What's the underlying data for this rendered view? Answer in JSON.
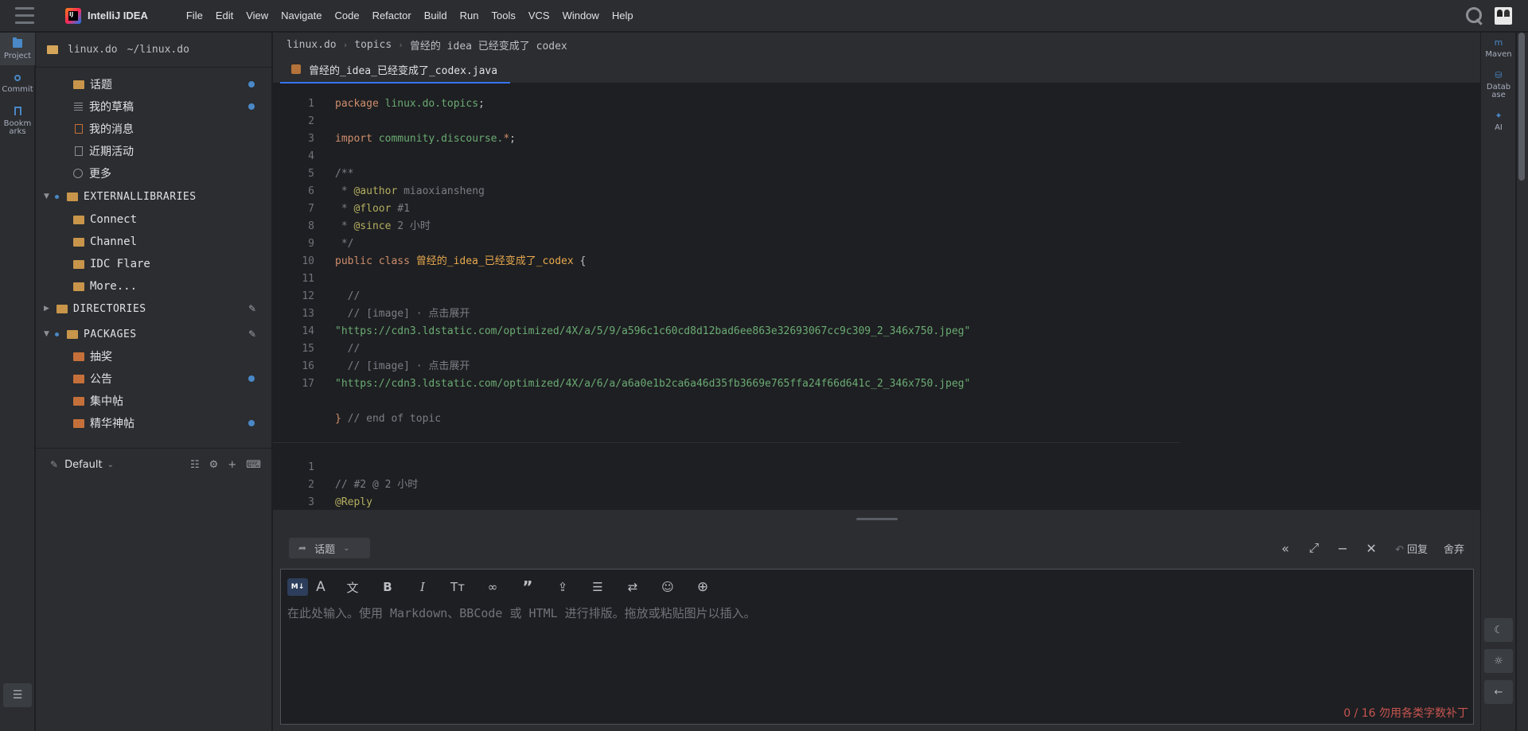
{
  "app": {
    "name": "IntelliJ IDEA"
  },
  "menu": [
    "File",
    "Edit",
    "View",
    "Navigate",
    "Code",
    "Refactor",
    "Build",
    "Run",
    "Tools",
    "VCS",
    "Window",
    "Help"
  ],
  "left_strip": [
    {
      "label": "Project",
      "icon": "folder-icon"
    },
    {
      "label": "Commit",
      "icon": "commit-icon"
    },
    {
      "label": "Bookmarks",
      "icon": "bookmark-icon"
    }
  ],
  "project": {
    "root": "linux.do",
    "path": "~/linux.do",
    "items": [
      {
        "label": "话题",
        "icon": "folder",
        "dot": true
      },
      {
        "label": "我的草稿",
        "icon": "lines",
        "dot": true
      },
      {
        "label": "我的消息",
        "icon": "file-orange",
        "dot": false
      },
      {
        "label": "近期活动",
        "icon": "file",
        "dot": false
      },
      {
        "label": "更多",
        "icon": "circle-x",
        "dot": false
      }
    ],
    "external": {
      "label": "EXTERNALLIBRARIES",
      "items": [
        "Connect",
        "Channel",
        "IDC Flare",
        "More..."
      ]
    },
    "directories": {
      "label": "DIRECTORIES"
    },
    "packages": {
      "label": "PACKAGES",
      "items": [
        {
          "label": "抽奖",
          "dot": false
        },
        {
          "label": "公告",
          "dot": true
        },
        {
          "label": "集中帖",
          "dot": false
        },
        {
          "label": "精华神帖",
          "dot": true
        }
      ]
    },
    "scheme": "Default"
  },
  "breadcrumb": [
    "linux.do",
    "topics",
    "曾经的 idea 已经变成了 codex"
  ],
  "tab": {
    "label": "曾经的_idea_已经变成了_codex.java"
  },
  "code": {
    "line1_kw": "package",
    "line1_pkg": "linux.do.topics",
    "line3_kw": "import",
    "line3_pkg": "community.discourse.",
    "line3_star": "*",
    "line5": "/**",
    "line6_tag": "@author",
    "line6_val": "miaoxiansheng",
    "line7_tag": "@floor",
    "line7_val": "#1",
    "line8_tag": "@since",
    "line8_val": "2 小时",
    "line9": " */",
    "line10_kw": "public class",
    "line10_cls": "曾经的_idea_已经变成了_codex",
    "line12": "  //",
    "line13": "  // [image] · 点击展开",
    "line14": "\"https://cdn3.ldstatic.com/optimized/4X/a/5/9/a596c1c60cd8d12bad6ee863e32693067cc9c309_2_346x750.jpeg\"",
    "line15": "  //",
    "line16": "  // [image] · 点击展开",
    "line17": "\"https://cdn3.ldstatic.com/optimized/4X/a/6/a/a6a0e1b2ca6a46d35fb3669e765ffa24f66d641c_2_346x750.jpeg\"",
    "end_brace": "}",
    "end_comment": "// end of topic",
    "reply_line2": "// #2 @ 2 小时",
    "reply_line3": "@Reply"
  },
  "right_strip": [
    {
      "label": "Maven",
      "icon": "maven-icon"
    },
    {
      "label": "Database",
      "icon": "database-icon"
    },
    {
      "label": "AI",
      "icon": "ai-sparkle-icon"
    }
  ],
  "composer": {
    "category": "话题",
    "reply_label": "回复",
    "discard_label": "舍弃",
    "placeholder": "在此处输入。使用 Markdown、BBCode 或 HTML 进行排版。拖放或粘贴图片以插入。",
    "char_count": "0 / 16 勿用各类字数补丁",
    "md_badge": "M↓"
  },
  "colors": {
    "accent": "#3574f0",
    "dot": "#4a88c7",
    "error": "#c75450"
  }
}
